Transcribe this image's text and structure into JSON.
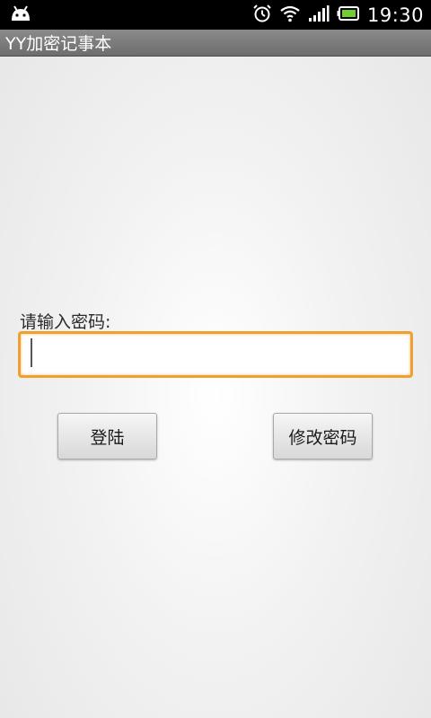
{
  "status_bar": {
    "time": "19:30",
    "icons": [
      "android-icon",
      "alarm-icon",
      "wifi-icon",
      "signal-icon",
      "battery-icon"
    ]
  },
  "app": {
    "title": "YY加密记事本"
  },
  "login": {
    "prompt": "请输入密码:",
    "password_value": "",
    "login_button": "登陆",
    "change_password_button": "修改密码"
  },
  "colors": {
    "status_bar": "#000000",
    "title_bar": "#7a7a7a",
    "input_focus_border": "#f0a030",
    "background": "#eeeeee"
  }
}
